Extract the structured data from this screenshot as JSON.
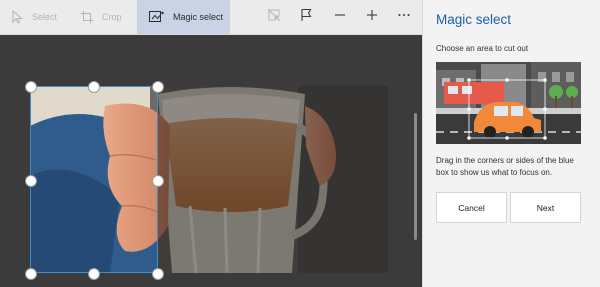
{
  "toolbar": {
    "select_label": "Select",
    "crop_label": "Crop",
    "magic_select_label": "Magic select"
  },
  "panel": {
    "title": "Magic select",
    "subtitle": "Choose an area to cut out",
    "help_text": "Drag in the corners or sides of the blue box to show us what to focus on.",
    "cancel_label": "Cancel",
    "next_label": "Next"
  },
  "colors": {
    "accent": "#1b5fa7",
    "selected_tool_bg": "#c9d3e6",
    "selection_border": "#3c8fcf",
    "canvas_bg": "#3b3b3b"
  }
}
